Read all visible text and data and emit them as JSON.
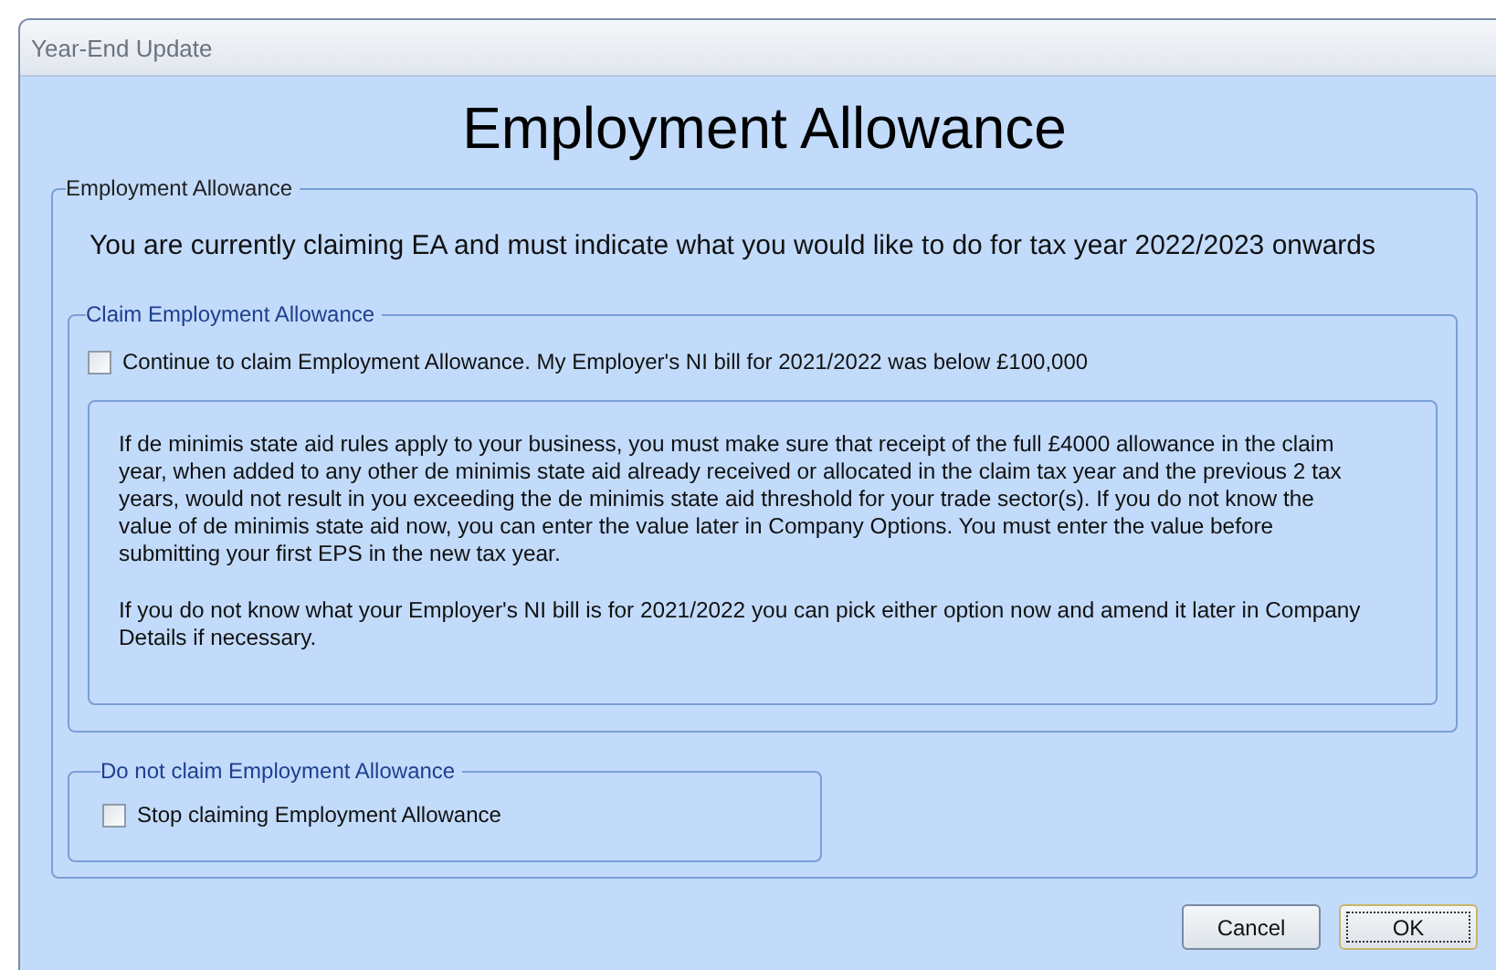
{
  "window": {
    "title": "Year-End Update"
  },
  "heading": "Employment Allowance",
  "main_group": {
    "title": "Employment Allowance",
    "intro": "You are currently claiming EA and must indicate what you would like to do for tax year 2022/2023 onwards",
    "claim_group": {
      "title": "Claim Employment Allowance",
      "option": {
        "label": "Continue to claim Employment Allowance. My Employer's NI bill for 2021/2022 was below £100,000",
        "checked": false
      },
      "info": [
        "If de minimis state aid rules apply to your business, you must make sure that receipt of the full £4000 allowance in the claim year, when added to any other de minimis state aid already received or allocated in the claim tax year and the previous 2 tax years, would not result in you exceeding the de minimis state aid threshold for your trade sector(s). If you do not know the value of de minimis state aid now, you can enter the value later in Company Options. You must enter the value before submitting your first EPS in the new tax year.",
        "If you do not know what your Employer's NI bill is for 2021/2022 you can pick either option now and amend it later in Company Details if necessary."
      ]
    },
    "stop_group": {
      "title": "Do not claim Employment Allowance",
      "option": {
        "label": "Stop claiming Employment Allowance",
        "checked": false
      }
    }
  },
  "buttons": [
    {
      "label": "Cancel",
      "default": false
    },
    {
      "label": "OK",
      "default": true
    }
  ]
}
